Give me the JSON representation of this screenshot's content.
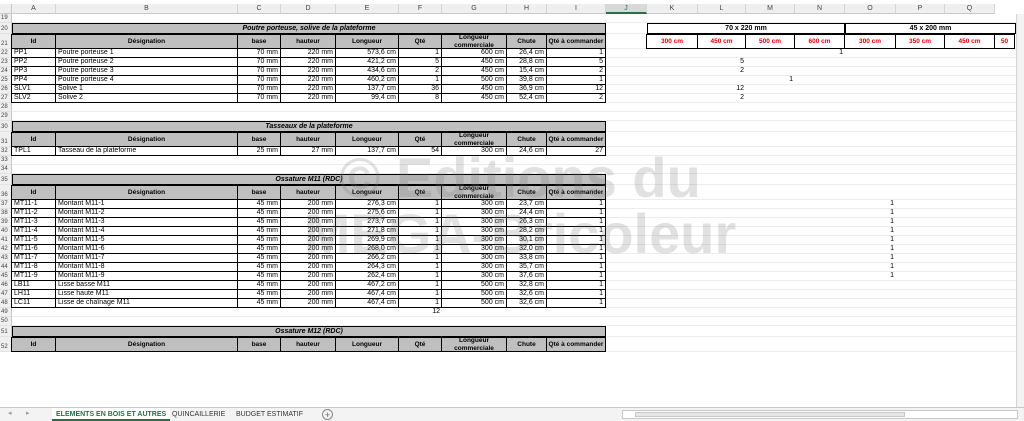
{
  "columns": [
    "A",
    "B",
    "C",
    "D",
    "E",
    "F",
    "G",
    "H",
    "I",
    "J",
    "K",
    "L",
    "M",
    "N",
    "O",
    "P",
    "Q"
  ],
  "selected_column": "J",
  "row_numbers": [
    "19",
    "20",
    "21",
    "22",
    "23",
    "24",
    "25",
    "26",
    "27",
    "28",
    "29",
    "30",
    "31",
    "32",
    "33",
    "34",
    "35",
    "36",
    "37",
    "38",
    "39",
    "40",
    "41",
    "42",
    "43",
    "44",
    "45",
    "46",
    "47",
    "48",
    "49",
    "50",
    "51",
    "52"
  ],
  "table_headers": {
    "id": "Id",
    "designation": "Désignation",
    "base": "base",
    "hauteur": "hauteur",
    "longueur": "Longueur",
    "qte": "Qté",
    "longueur_commerciale": "Longueur commerciale",
    "chute": "Chute",
    "qte_commander": "Qté à commander"
  },
  "sections": [
    {
      "title": "Poutre porteuse, solive de la plateforme",
      "rows": [
        [
          "PP1",
          "Poutre porteuse 1",
          "70 mm",
          "220 mm",
          "573,6 cm",
          "1",
          "600 cm",
          "26,4 cm",
          "1"
        ],
        [
          "PP2",
          "Poutre porteuse 2",
          "70 mm",
          "220 mm",
          "421,2 cm",
          "5",
          "450 cm",
          "28,8 cm",
          "5"
        ],
        [
          "PP3",
          "Poutre porteuse 3",
          "70 mm",
          "220 mm",
          "434,6 cm",
          "2",
          "450 cm",
          "15,4 cm",
          "2"
        ],
        [
          "PP4",
          "Poutre porteuse 4",
          "70 mm",
          "220 mm",
          "460,2 cm",
          "1",
          "500 cm",
          "39,8 cm",
          "1"
        ],
        [
          "SLV1",
          "Solive 1",
          "70 mm",
          "220 mm",
          "137,7 cm",
          "36",
          "450 cm",
          "36,9 cm",
          "12"
        ],
        [
          "SLV2",
          "Solive 2",
          "70 mm",
          "220 mm",
          "99,4 cm",
          "8",
          "450 cm",
          "52,4 cm",
          "2"
        ]
      ]
    },
    {
      "title": "Tasseaux de la plateforme",
      "rows": [
        [
          "TPL1",
          "Tasseau de la plateforme",
          "25 mm",
          "27 mm",
          "137,7 cm",
          "54",
          "300 cm",
          "24,6 cm",
          "27"
        ]
      ]
    },
    {
      "title": "Ossature M11 (RDC)",
      "rows": [
        [
          "MT11-1",
          "Montant M11-1",
          "45 mm",
          "200 mm",
          "276,3 cm",
          "1",
          "300 cm",
          "23,7 cm",
          "1"
        ],
        [
          "MT11-2",
          "Montant M11-2",
          "45 mm",
          "200 mm",
          "275,6 cm",
          "1",
          "300 cm",
          "24,4 cm",
          "1"
        ],
        [
          "MT11-3",
          "Montant M11-3",
          "45 mm",
          "200 mm",
          "273,7 cm",
          "1",
          "300 cm",
          "26,3 cm",
          "1"
        ],
        [
          "MT11-4",
          "Montant M11-4",
          "45 mm",
          "200 mm",
          "271,8 cm",
          "1",
          "300 cm",
          "28,2 cm",
          "1"
        ],
        [
          "MT11-5",
          "Montant M11-5",
          "45 mm",
          "200 mm",
          "269,9 cm",
          "1",
          "300 cm",
          "30,1 cm",
          "1"
        ],
        [
          "MT11-6",
          "Montant M11-6",
          "45 mm",
          "200 mm",
          "268,0 cm",
          "1",
          "300 cm",
          "32,0 cm",
          "1"
        ],
        [
          "MT11-7",
          "Montant M11-7",
          "45 mm",
          "200 mm",
          "266,2 cm",
          "1",
          "300 cm",
          "33,8 cm",
          "1"
        ],
        [
          "MT11-8",
          "Montant M11-8",
          "45 mm",
          "200 mm",
          "264,3 cm",
          "1",
          "300 cm",
          "35,7 cm",
          "1"
        ],
        [
          "MT11-9",
          "Montant M11-9",
          "45 mm",
          "200 mm",
          "262,4 cm",
          "1",
          "300 cm",
          "37,6 cm",
          "1"
        ],
        [
          "LB11",
          "Lisse basse M11",
          "45 mm",
          "200 mm",
          "467,2 cm",
          "1",
          "500 cm",
          "32,8 cm",
          "1"
        ],
        [
          "LH11",
          "Lisse haute M11",
          "45 mm",
          "200 mm",
          "467,4 cm",
          "1",
          "500 cm",
          "32,6 cm",
          "1"
        ],
        [
          "LC11",
          "Lisse de chaînage M11",
          "45 mm",
          "200 mm",
          "467,4 cm",
          "1",
          "500 cm",
          "32,6 cm",
          "1"
        ]
      ],
      "total_qte": "12"
    },
    {
      "title": "Ossature M12 (RDC)",
      "rows": []
    }
  ],
  "right_headers": {
    "group1": "70 x 220 mm",
    "group2": "45 x 200 mm",
    "group1_sizes": [
      "300 cm",
      "450 cm",
      "500 cm",
      "600 cm"
    ],
    "group2_sizes": [
      "300 cm",
      "350 cm",
      "450 cm",
      "50"
    ]
  },
  "right_values": {
    "pp1_600": "1",
    "pp2_450": "5",
    "pp3_450": "2",
    "pp4_500": "1",
    "slv1_450": "12",
    "slv2_450": "2",
    "m11_300": [
      "1",
      "1",
      "1",
      "1",
      "1",
      "1",
      "1",
      "1",
      "1"
    ]
  },
  "watermark": {
    "line1": "© Editions du",
    "line2": "MEGA-Bricoleur"
  },
  "sheet_tabs": [
    "ELEMENTS EN BOIS ET AUTRES",
    "QUINCAILLERIE",
    "BUDGET ESTIMATIF"
  ],
  "add_sheet": "+",
  "nav_prev": "◂",
  "nav_next": "▸"
}
